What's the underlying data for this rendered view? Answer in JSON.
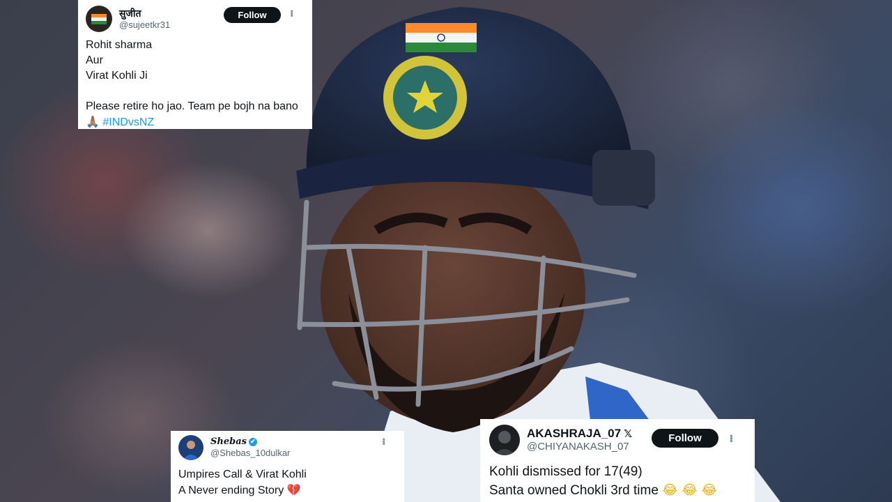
{
  "tweets": [
    {
      "display_name": "सुजीत",
      "handle": "@sujeetkr31",
      "follow_label": "Follow",
      "text_lines": "Rohit sharma\nAur\nVirat Kohli Ji\n\nPlease retire ho jao. Team pe bojh na bano",
      "emoji": "🙏🏽",
      "hashtag": "#INDvsNZ"
    },
    {
      "display_name": "Shebas",
      "verified_icon": "✔",
      "handle": "@Shebas_10dulkar",
      "text_lines": "Umpires Call & Virat Kohli\nA Never ending Story",
      "emoji": "💔"
    },
    {
      "display_name": "AKASHRAJA_07",
      "x_icon": "𝕏",
      "handle": "@CHIYANAKASH_07",
      "follow_label": "Follow",
      "text_lines": "Kohli dismissed for 17(49)\nSanta owned Chokli 3rd time",
      "emoji": "😂 😂 😂"
    }
  ],
  "more_icon": "•••",
  "icons": {
    "tweet_more": "more-options-icon",
    "verified": "verified-badge-icon",
    "x": "x-logo-icon"
  },
  "colors": {
    "follow_button": "#0f1419",
    "hashtag": "#1d9bf0",
    "handle": "#536471",
    "helmet": "#1e2b45",
    "flag_saffron": "#ff8a2a",
    "flag_green": "#2a8a3a"
  }
}
